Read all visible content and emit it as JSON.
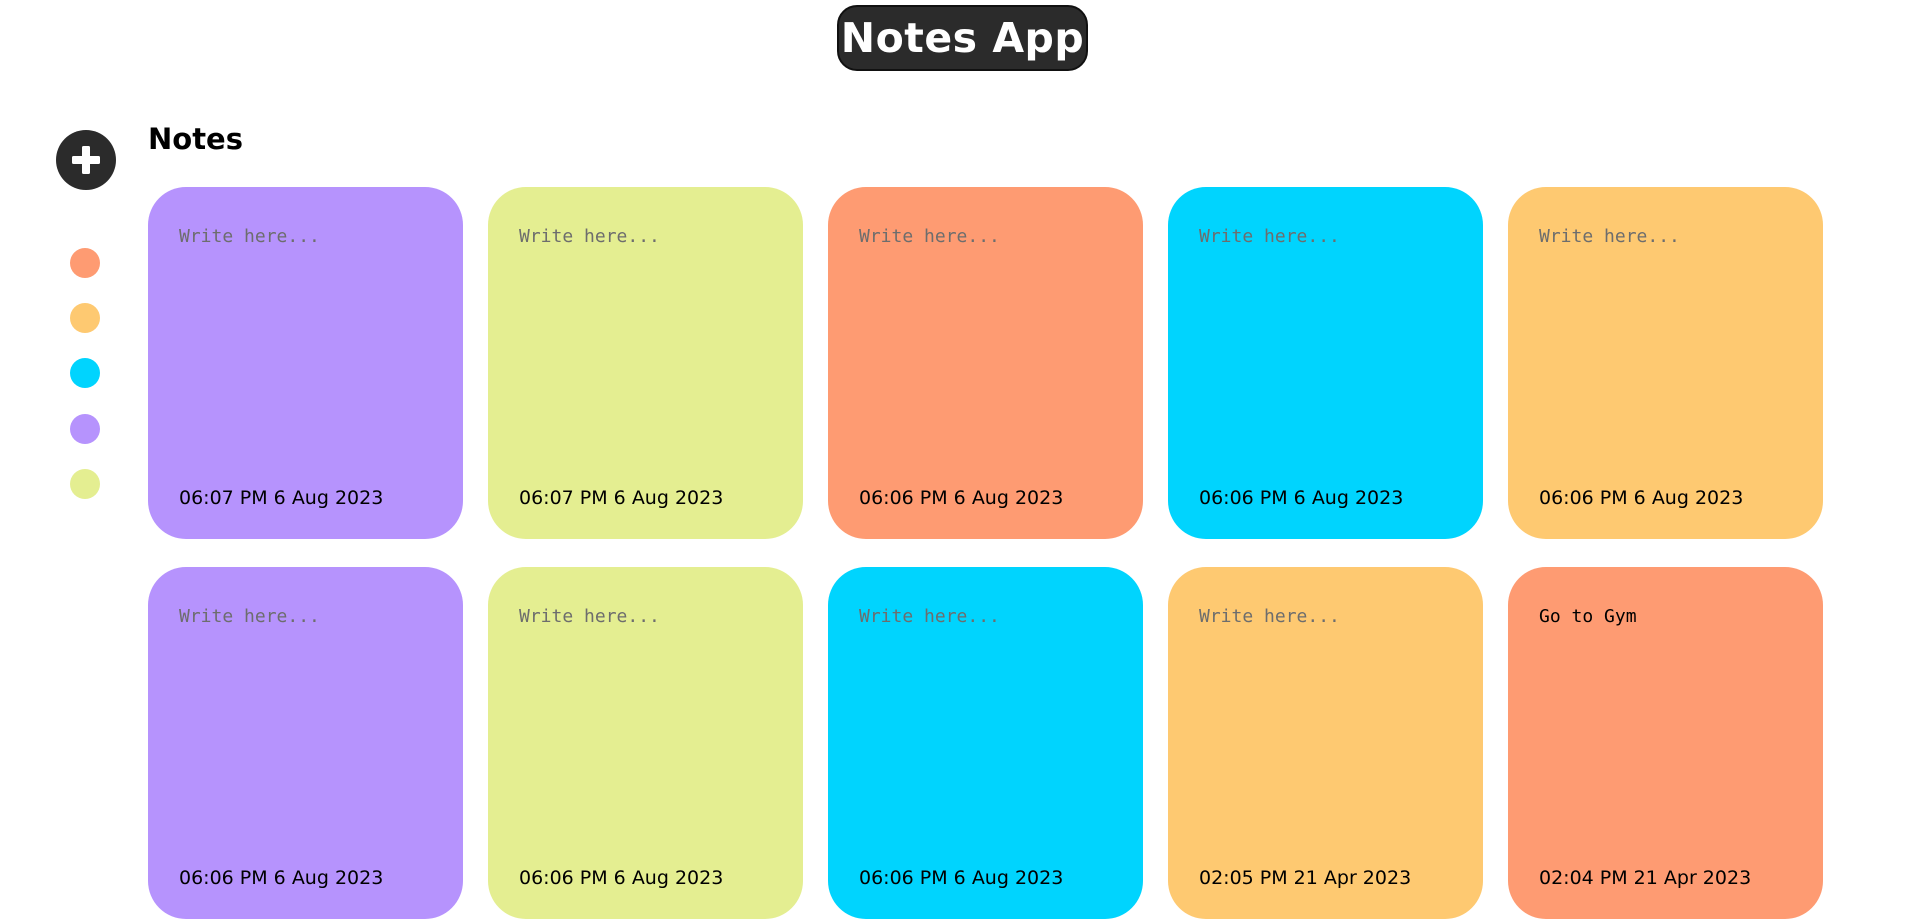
{
  "app": {
    "title": "Notes App"
  },
  "sidebar": {
    "add_icon": "plus-icon",
    "colors": [
      "#fe9b72",
      "#fec971",
      "#00d4fe",
      "#b693fd",
      "#e4ee91"
    ]
  },
  "main": {
    "heading": "Notes",
    "placeholder": "Write here...",
    "notes": [
      {
        "text": "",
        "time": "06:07 PM 6 Aug 2023",
        "color": "#b693fd"
      },
      {
        "text": "",
        "time": "06:07 PM 6 Aug 2023",
        "color": "#e4ee91"
      },
      {
        "text": "",
        "time": "06:06 PM 6 Aug 2023",
        "color": "#fe9b72"
      },
      {
        "text": "",
        "time": "06:06 PM 6 Aug 2023",
        "color": "#00d4fe"
      },
      {
        "text": "",
        "time": "06:06 PM 6 Aug 2023",
        "color": "#fec971"
      },
      {
        "text": "",
        "time": "06:06 PM 6 Aug 2023",
        "color": "#b693fd"
      },
      {
        "text": "",
        "time": "06:06 PM 6 Aug 2023",
        "color": "#e4ee91"
      },
      {
        "text": "",
        "time": "06:06 PM 6 Aug 2023",
        "color": "#00d4fe"
      },
      {
        "text": "",
        "time": "02:05 PM 21 Apr 2023",
        "color": "#fec971"
      },
      {
        "text": "Go to Gym",
        "time": "02:04 PM 21 Apr 2023",
        "color": "#fe9b72"
      }
    ]
  }
}
